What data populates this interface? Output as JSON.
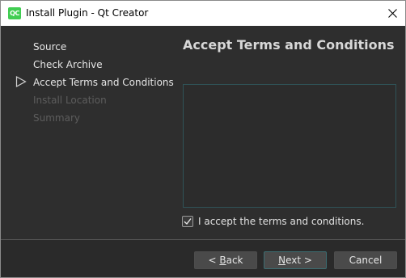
{
  "window": {
    "app_icon_text": "QC",
    "title": "Install Plugin - Qt Creator",
    "close_icon": "close-icon"
  },
  "wizard": {
    "steps": [
      {
        "label": "Source",
        "state": "done"
      },
      {
        "label": "Check Archive",
        "state": "done"
      },
      {
        "label": "Accept Terms and Conditions",
        "state": "current"
      },
      {
        "label": "Install Location",
        "state": "pending"
      },
      {
        "label": "Summary",
        "state": "pending"
      }
    ],
    "current_marker_icon": "triangle-right-outline-icon"
  },
  "page": {
    "title": "Accept Terms and Conditions",
    "terms_text": "",
    "accept_checked": true,
    "accept_label": "I accept the terms and conditions."
  },
  "buttons": {
    "back": {
      "mnemonic": "B",
      "rest": "ack",
      "prefix": "< "
    },
    "next": {
      "mnemonic": "N",
      "rest": "ext >"
    },
    "cancel": "Cancel"
  },
  "colors": {
    "accent": "#41cd52",
    "background": "#2e2e2e",
    "focus_border": "#3c6d71"
  }
}
